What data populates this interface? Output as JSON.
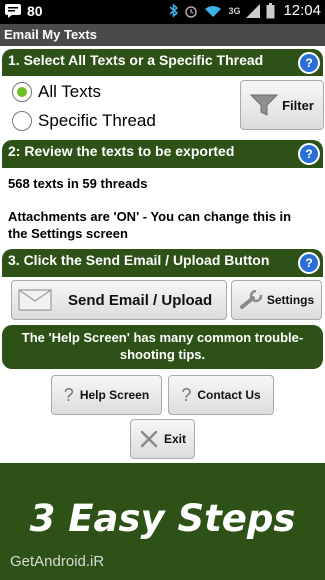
{
  "status_bar": {
    "notification_count": "80",
    "network_type": "3G",
    "time": "12:04"
  },
  "app": {
    "title": "Email My Texts"
  },
  "step1": {
    "title": "1. Select All Texts or a Specific Thread",
    "help_label": "?",
    "option_all": "All Texts",
    "option_specific": "Specific Thread",
    "selected": "All Texts",
    "filter_label": "Filter"
  },
  "step2": {
    "title": "2: Review the texts to be exported",
    "help_label": "?",
    "summary": "568 texts in 59 threads",
    "attachments_line1": "Attachments are 'ON' - You can change this in",
    "attachments_line2": "the Settings screen"
  },
  "step3": {
    "title": "3. Click the Send Email / Upload Button",
    "help_label": "?",
    "send_label": "Send Email / Upload",
    "settings_label": "Settings"
  },
  "help_note": {
    "line1": "The 'Help Screen' has many common trouble-",
    "line2": "shooting tips."
  },
  "buttons": {
    "help_screen": "Help Screen",
    "contact_us": "Contact Us",
    "exit": "Exit",
    "question_glyph": "?"
  },
  "promo": {
    "headline": "3 Easy Steps",
    "watermark": "GetAndroid.iR"
  },
  "colors": {
    "section_green": "#2d5117",
    "help_blue": "#2a6fd6",
    "radio_green": "#6cc020"
  }
}
